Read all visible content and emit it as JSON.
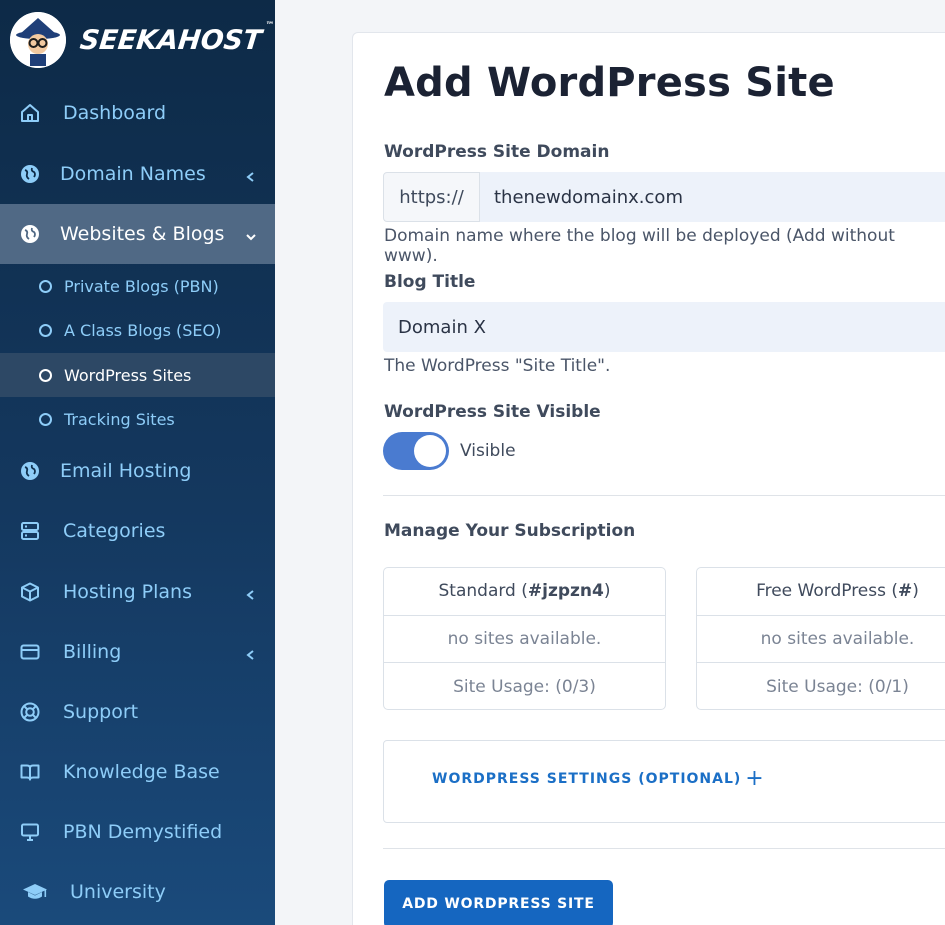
{
  "brand": {
    "name": "SEEKAHOST",
    "trademark": "™"
  },
  "sidebar": {
    "items": [
      {
        "label": "Dashboard",
        "icon": "home-icon"
      },
      {
        "label": "Domain Names",
        "icon": "globe-icon",
        "chevron": "chevron-left-icon"
      },
      {
        "label": "Websites & Blogs",
        "icon": "globe-icon",
        "chevron": "chevron-down-icon",
        "active": true
      },
      {
        "label": "Email Hosting",
        "icon": "globe-icon"
      },
      {
        "label": "Categories",
        "icon": "server-icon"
      },
      {
        "label": "Hosting Plans",
        "icon": "box-icon",
        "chevron": "chevron-left-icon"
      },
      {
        "label": "Billing",
        "icon": "credit-card-icon",
        "chevron": "chevron-left-icon"
      },
      {
        "label": "Support",
        "icon": "lifebuoy-icon"
      },
      {
        "label": "Knowledge Base",
        "icon": "book-icon"
      },
      {
        "label": "PBN Demystified",
        "icon": "monitor-icon"
      },
      {
        "label": "University",
        "icon": "graduation-cap-icon"
      }
    ],
    "subitems": [
      {
        "label": "Private Blogs (PBN)"
      },
      {
        "label": "A Class Blogs (SEO)"
      },
      {
        "label": "WordPress Sites",
        "active": true
      },
      {
        "label": "Tracking Sites"
      }
    ]
  },
  "main": {
    "title": "Add WordPress Site",
    "domain": {
      "label": "WordPress Site Domain",
      "prefix": "https://",
      "value": "thenewdomainx.com",
      "help": "Domain name where the blog will be deployed (Add without www)."
    },
    "blog_title": {
      "label": "Blog Title",
      "value": "Domain X",
      "help": "The WordPress \"Site Title\"."
    },
    "visibility": {
      "label": "WordPress Site Visible",
      "state_label": "Visible",
      "on": true
    },
    "subscription": {
      "heading": "Manage Your Subscription",
      "cards": [
        {
          "name": "Standard",
          "code": "#jzpzn4",
          "status": "no sites available.",
          "usage": "Site Usage: (0/3)"
        },
        {
          "name": "Free WordPress",
          "code": "#",
          "status": "no sites available.",
          "usage": "Site Usage: (0/1)"
        }
      ]
    },
    "settings_link": "WORDPRESS SETTINGS (OPTIONAL)",
    "submit_label": "ADD WORDPRESS SITE"
  },
  "colors": {
    "sidebar_top": "#0d2a47",
    "sidebar_bottom": "#1a4a7b",
    "sidebar_text": "#8ecdf8",
    "active_bg": "#506985",
    "accent": "#1566c0",
    "toggle_on": "#4a7bd0"
  }
}
